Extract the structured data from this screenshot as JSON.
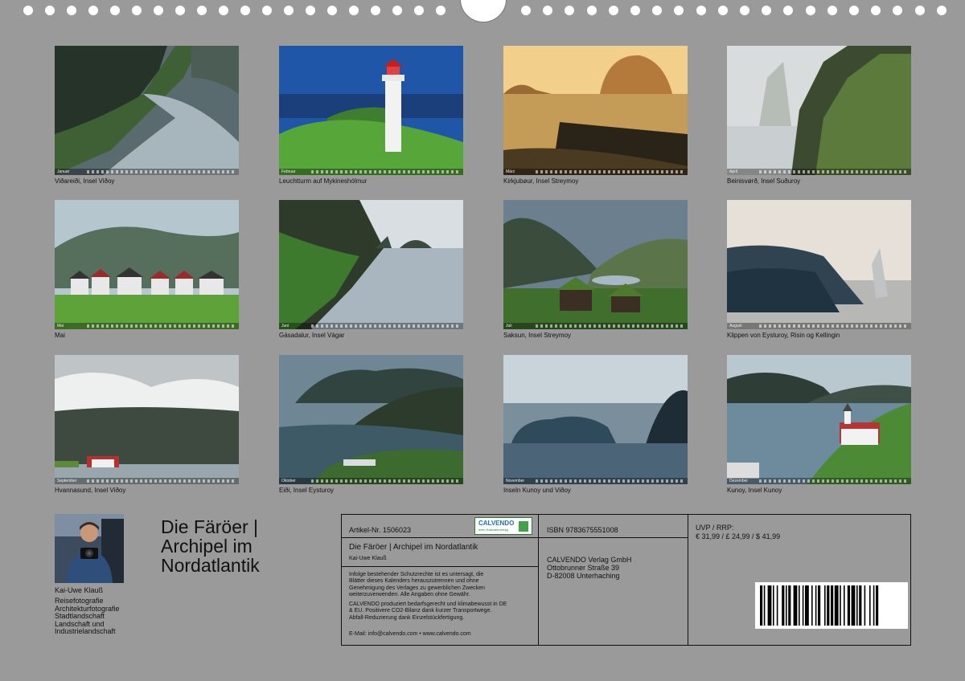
{
  "photos": [
    {
      "caption": "Viðareiði, Insel Viðoy",
      "month": "Januar"
    },
    {
      "caption": "Leuchtturm auf Mykineshólmur",
      "month": "Februar"
    },
    {
      "caption": "Kirkjubøur, Insel Streymoy",
      "month": "März"
    },
    {
      "caption": "Beinisvørð, Insel Suðuroy",
      "month": "April"
    },
    {
      "caption": "Mai",
      "month": "Mai"
    },
    {
      "caption": "Gásadalur, Insel Vágar",
      "month": "Juni"
    },
    {
      "caption": "Saksun, Insel Streymoy",
      "month": "Juli"
    },
    {
      "caption": "Klippen von Eysturoy, Risin og Kellingin",
      "month": "August"
    },
    {
      "caption": "Hvannasund, Insel Viðoy",
      "month": "September"
    },
    {
      "caption": "Eiði, Insel Eysturoy",
      "month": "Oktober"
    },
    {
      "caption": "Inseln Kunoy und Viðoy",
      "month": "November"
    },
    {
      "caption": "Kunoy, Insel Kunoy",
      "month": "Dezember"
    }
  ],
  "author": {
    "name": "Kai-Uwe Klauß",
    "tags": [
      "Reisefotografie",
      "Architekturfotografie",
      "Stadtlandschaft",
      "Landschaft und",
      "Industrielandschaft"
    ]
  },
  "title": {
    "line1": "Die Färöer |",
    "line2": "Archipel im",
    "line3": "Nordatlantik"
  },
  "info": {
    "article": "Artikel-Nr. 1506023",
    "calvendo_logo": "CALVENDO",
    "calvendo_slogan": "mein Kalenderverlag",
    "product_title": "Die Färöer | Archipel im Nordatlantik",
    "product_author": "Kai-Uwe Klauß",
    "legal1": [
      "Infolge bestehender Schutzrechte ist es untersagt, die",
      "Blätter dieses Kalenders herauszutrennen und ohne",
      "Genehmigung des Verlages zu gewerblichen Zwecken",
      "weiterzuverwenden. Alle Angaben ohne Gewähr."
    ],
    "legal2": [
      "CALVENDO produziert bedarfsgerecht und klimabewusst in DE",
      "& EU. Positivere CO2-Bilanz dank kurzer Transportwege.",
      "Abfall-Reduzierung dank Einzelstückfertigung."
    ],
    "contact": "E-Mail: info@calvendo.com • www.calvendo.com",
    "isbn": "ISBN 9783675551008",
    "publisher": [
      "CALVENDO Verlag GmbH",
      "Ottobrunner Straße 39",
      "D-82008 Unterhaching"
    ],
    "price_label": "UVP / RRP:",
    "price": "€ 31,99 / £ 24,99 / $ 41,99"
  }
}
